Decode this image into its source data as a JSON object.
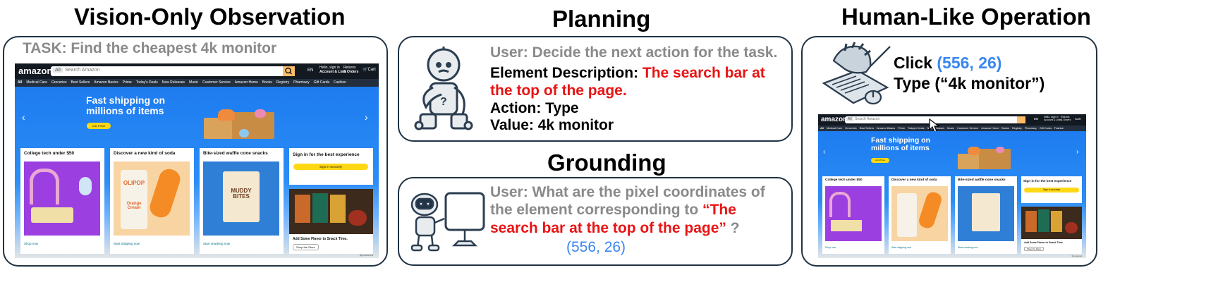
{
  "sections": {
    "observation_title": "Vision-Only Observation",
    "planning_title": "Planning",
    "grounding_title": "Grounding",
    "operation_title": "Human-Like Operation"
  },
  "observation": {
    "task": "TASK: Find the cheapest 4k monitor"
  },
  "planning": {
    "user": "User: Decide the next action for the task.",
    "desc_label": "Element Description:",
    "desc_line1": "The search bar at",
    "desc_line2": "the top of the page.",
    "action": "Action: Type",
    "value": "Value: 4k monitor"
  },
  "grounding": {
    "line1": "User: What are the pixel coordinates of",
    "line2_gray": "the element corresponding to",
    "line2_red": "“The",
    "line3_red": "search bar at the top of the page”",
    "line3_gray": "?",
    "answer": "(556, 26)"
  },
  "operation": {
    "click_label": "Click",
    "click_coords": "(556, 26)",
    "type_text": "Type (“4k monitor”)"
  },
  "amazon": {
    "logo": "amazon",
    "search_scope": "All",
    "search_placeholder": "Search Amazon",
    "lang": "EN",
    "account_line1": "Hello, sign in",
    "account_line2": "Account & Lists",
    "orders_line1": "Returns",
    "orders_line2": "& Orders",
    "cart": "Cart",
    "nav_items": [
      "All",
      "Medical Care",
      "Groceries",
      "Best Sellers",
      "Amazon Basics",
      "Prime",
      "Today's Deals",
      "New Releases",
      "Music",
      "Customer Service",
      "Amazon Home",
      "Books",
      "Registry",
      "Pharmacy",
      "Gift Cards",
      "Fashion"
    ],
    "hero_line1": "Fast shipping on",
    "hero_line2": "millions of items",
    "hero_button": "Join Prime",
    "cards": [
      {
        "title": "College tech under $50",
        "link": "Shop now"
      },
      {
        "title": "Discover a new kind of soda",
        "link": "Start shipping now"
      },
      {
        "title": "Bite-sized waffle cone snacks",
        "link": "Start snacking now"
      },
      {
        "title": "Sign in for the best experience",
        "button": "Sign in securely"
      }
    ],
    "ad_title": "Add Some Flavor to Snack Time.",
    "ad_button": "Shop the Store",
    "sponsored": "Sponsored",
    "soda_brand": "OLIPOP",
    "soda_flavor": "Orange Cream",
    "snack_brand": "MUDDY BITES"
  },
  "colors": {
    "panel_border": "#1f3344",
    "red": "#e81414",
    "blue": "#3a86ef",
    "gray": "#8a8a8a",
    "amazon_dark": "#131921",
    "amazon_nav": "#232f3e",
    "amazon_blue": "#1e7cf0"
  }
}
